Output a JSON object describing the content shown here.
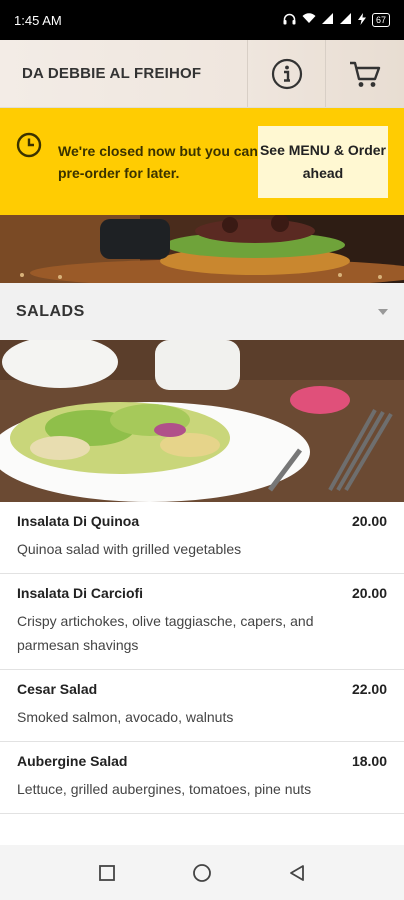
{
  "status_bar": {
    "time": "1:45 AM",
    "battery": "67"
  },
  "header": {
    "title": "DA DEBBIE AL FREIHOF",
    "info_icon": "info-icon",
    "cart_icon": "cart-icon"
  },
  "banner": {
    "message": "We're closed now but you can pre-order for later.",
    "action_label": "See MENU & Order ahead",
    "color": "#ffcc02"
  },
  "category": {
    "title": "SALADS"
  },
  "menu_items": [
    {
      "name": "Insalata Di Quinoa",
      "price": "20.00",
      "description": "Quinoa salad with grilled vegetables"
    },
    {
      "name": "Insalata Di Carciofi",
      "price": "20.00",
      "description": "Crispy artichokes, olive taggiasche, capers, and parmesan shavings"
    },
    {
      "name": "Cesar Salad",
      "price": "22.00",
      "description": "Smoked salmon, avocado, walnuts"
    },
    {
      "name": "Aubergine Salad",
      "price": "18.00",
      "description": "Lettuce, grilled aubergines, tomatoes, pine nuts"
    }
  ],
  "nav": {
    "recents": "square-icon",
    "home": "circle-icon",
    "back": "triangle-back-icon"
  }
}
